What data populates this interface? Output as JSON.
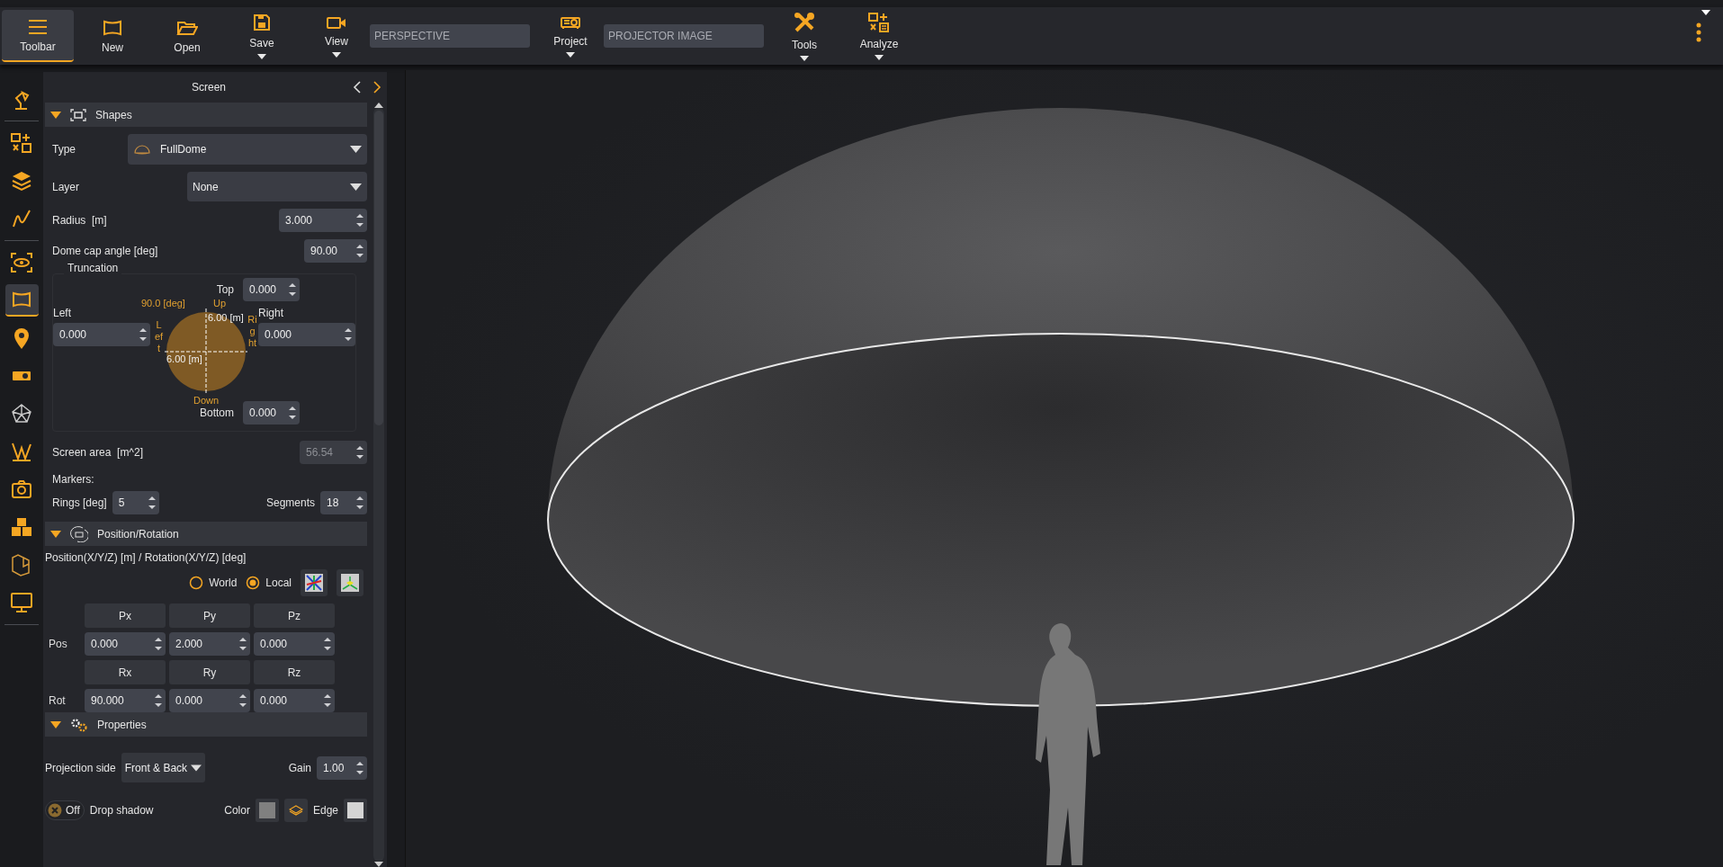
{
  "toolbar": {
    "items": [
      {
        "kind": "button",
        "label": "Toolbar",
        "selected": true,
        "menu": false
      },
      {
        "kind": "button",
        "label": "New",
        "selected": false,
        "menu": false
      },
      {
        "kind": "button",
        "label": "Open",
        "selected": false,
        "menu": false
      },
      {
        "kind": "button",
        "label": "Save",
        "selected": false,
        "menu": true
      },
      {
        "kind": "button",
        "label": "View",
        "selected": false,
        "menu": true
      },
      {
        "kind": "field",
        "text": "PERSPECTIVE"
      },
      {
        "kind": "button",
        "label": "Project",
        "selected": false,
        "menu": true
      },
      {
        "kind": "field",
        "text": "PROJECTOR IMAGE"
      },
      {
        "kind": "button",
        "label": "Tools",
        "selected": false,
        "menu": true
      },
      {
        "kind": "button",
        "label": "Analyze",
        "selected": false,
        "menu": true
      }
    ],
    "more_menu": true
  },
  "rail": {
    "groups": [
      {
        "items": [
          {
            "selected": false
          }
        ]
      },
      {
        "items": [
          {
            "selected": false
          },
          {
            "selected": false
          },
          {
            "selected": false
          }
        ]
      },
      {
        "items": [
          {
            "selected": false
          },
          {
            "selected": true
          },
          {
            "selected": false
          },
          {
            "selected": false
          },
          {
            "selected": false
          },
          {
            "selected": false
          },
          {
            "selected": false
          },
          {
            "selected": false
          },
          {
            "selected": false
          },
          {
            "selected": false
          }
        ]
      }
    ]
  },
  "panel": {
    "title": "Screen",
    "sections": [
      {
        "kind": "shapes",
        "title": "Shapes",
        "expanded": true,
        "type": {
          "label": "Type",
          "value": "FullDome"
        },
        "layer": {
          "label": "Layer",
          "value": "None"
        },
        "radius": {
          "label": "Radius  [m]",
          "value": "3.000"
        },
        "cap_angle": {
          "label": "Dome cap angle [deg]",
          "value": "90.00"
        },
        "truncation": {
          "title": "Truncation",
          "top": {
            "label": "Top",
            "value": "0.000"
          },
          "left": {
            "label": "Left",
            "value": "0.000"
          },
          "right": {
            "label": "Right",
            "value": "0.000"
          },
          "bottom": {
            "label": "Bottom",
            "value": "0.000"
          },
          "diagram": {
            "angle": "90.0 [deg]",
            "up": "Up",
            "left": "Left",
            "right": "Right",
            "down": "Down",
            "width": "6.00 [m]",
            "height": "6.00 [m]"
          }
        },
        "area": {
          "label": "Screen area  [m^2]",
          "value": "56.54",
          "disabled": true
        },
        "markers_label": "Markers:",
        "rings": {
          "label": "Rings [deg]",
          "value": "5"
        },
        "segments": {
          "label": "Segments",
          "value": "18"
        }
      },
      {
        "kind": "position",
        "title": "Position/Rotation",
        "expanded": true,
        "caption": "Position(X/Y/Z) [m] / Rotation(X/Y/Z) [deg]",
        "frames": [
          {
            "label": "World",
            "selected": false
          },
          {
            "label": "Local",
            "selected": true
          }
        ],
        "rows": [
          {
            "label": "Pos",
            "headers": [
              "Px",
              "Py",
              "Pz"
            ],
            "values": [
              "0.000",
              "2.000",
              "0.000"
            ]
          },
          {
            "label": "Rot",
            "headers": [
              "Rx",
              "Ry",
              "Rz"
            ],
            "values": [
              "90.000",
              "0.000",
              "0.000"
            ]
          }
        ]
      },
      {
        "kind": "properties",
        "title": "Properties",
        "expanded": true,
        "projection": {
          "label": "Projection side",
          "value": "Front & Back"
        },
        "gain": {
          "label": "Gain",
          "value": "1.00"
        },
        "shadow": {
          "on": false,
          "state_text": "Off",
          "label": "Drop shadow"
        },
        "color": {
          "label": "Color",
          "color": "#808080"
        },
        "edge": {
          "label": "Edge",
          "color": "#d4d4d4"
        }
      }
    ]
  }
}
